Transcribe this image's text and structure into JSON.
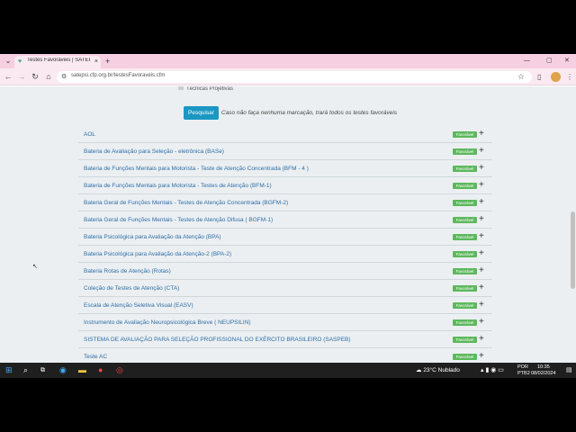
{
  "browser": {
    "tab_title": "Testes Favoráveis | SATEPSI",
    "new_tab": "+",
    "close_tab": "×",
    "url": "satepsi.cfp.org.br/testesFavoraveis.cfm"
  },
  "filter": {
    "cut_item": "Técnicas Projetivas",
    "search_button": "Pesquisar",
    "hint": "Caso não faça nenhuma marcação, trará todos os testes favoráveis"
  },
  "tests": [
    {
      "name": "AOL",
      "badge": "Favorável"
    },
    {
      "name": "Bateria de Avaliação para Seleção - eletrônica (BASe)",
      "badge": "Favorável"
    },
    {
      "name": "Bateria de Funções Mentais para Motorista - Teste de Atenção Concentrada (BFM - 4 )",
      "badge": "Favorável"
    },
    {
      "name": "Bateria de Funções Mentais para Motorista - Testes de Atenção (BFM-1)",
      "badge": "Favorável"
    },
    {
      "name": "Bateria Geral de Funções Mentais - Testes de Atenção Concentrada (BGFM-2)",
      "badge": "Favorável"
    },
    {
      "name": "Bateria Geral de Funções Mentais - Testes de Atenção Difusa ( BGFM-1)",
      "badge": "Favorável"
    },
    {
      "name": "Bateria Psicológica para Avaliação da Atenção (BPA)",
      "badge": "Favorável"
    },
    {
      "name": "Bateria Psicológica para Avaliação da Atenção-2 (BPA-2)",
      "badge": "Favorável"
    },
    {
      "name": "Bateria Rotas de Atenção (Rotas)",
      "badge": "Favorável"
    },
    {
      "name": "Coleção de Testes de Atenção (CTA)",
      "badge": "Favorável"
    },
    {
      "name": "Escala de Atenção Seletiva Visual (EASV)",
      "badge": "Favorável"
    },
    {
      "name": "Instrumento de Avaliação Neuropsicológica Breve ( NEUPSILIN)",
      "badge": "Favorável"
    },
    {
      "name": "SISTEMA DE AVALIAÇÃO PARA SELEÇÃO PROFISSIONAL DO EXÉRCITO BRASILEIRO (SASPEB)",
      "badge": "Favorável"
    },
    {
      "name": "Teste AC",
      "badge": "Favorável"
    }
  ],
  "taskbar": {
    "weather": "23°C  Nublado",
    "lang1": "POR",
    "lang2": "PTB2",
    "time": "10:35",
    "date": "08/02/2024"
  },
  "colors": {
    "accent": "#1b97c3",
    "badge": "#5cb85c",
    "link": "#2c6ea8"
  }
}
